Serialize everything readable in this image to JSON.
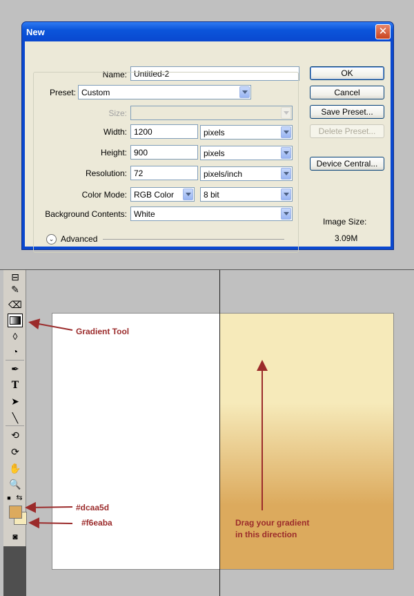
{
  "dialog": {
    "title": "New",
    "name_label": "Name:",
    "name_value": "Untitled-2",
    "preset_label": "Preset:",
    "preset_value": "Custom",
    "size_label": "Size:",
    "size_value": "",
    "width_label": "Width:",
    "width_value": "1200",
    "width_unit": "pixels",
    "height_label": "Height:",
    "height_value": "900",
    "height_unit": "pixels",
    "resolution_label": "Resolution:",
    "resolution_value": "72",
    "resolution_unit": "pixels/inch",
    "color_mode_label": "Color Mode:",
    "color_mode_value": "RGB Color",
    "bit_depth_value": "8 bit",
    "background_label": "Background Contents:",
    "background_value": "White",
    "advanced_label": "Advanced",
    "buttons": {
      "ok": "OK",
      "cancel": "Cancel",
      "save_preset": "Save Preset...",
      "delete_preset": "Delete Preset...",
      "device_central": "Device Central..."
    },
    "image_size_label": "Image Size:",
    "image_size_value": "3.09M"
  },
  "workspace": {
    "annotations": {
      "gradient_tool": "Gradient Tool",
      "fg_color": "#dcaa5d",
      "bg_color": "#f6eaba",
      "drag_line1": "Drag your gradient",
      "drag_line2": "in this direction"
    },
    "colors": {
      "foreground": "#dcaa5d",
      "background": "#f6eaba",
      "annotation": "#9b2b2b",
      "title_bar": "#0a48cf"
    },
    "tools": [
      "crop-icon",
      "brush-icon",
      "eraser-icon",
      "gradient-icon",
      "blur-icon",
      "dodge-icon",
      "pen-icon",
      "type-icon",
      "path-select-icon",
      "line-icon",
      "3d-rotate-icon",
      "3d-orbit-icon",
      "hand-icon",
      "zoom-icon"
    ]
  }
}
